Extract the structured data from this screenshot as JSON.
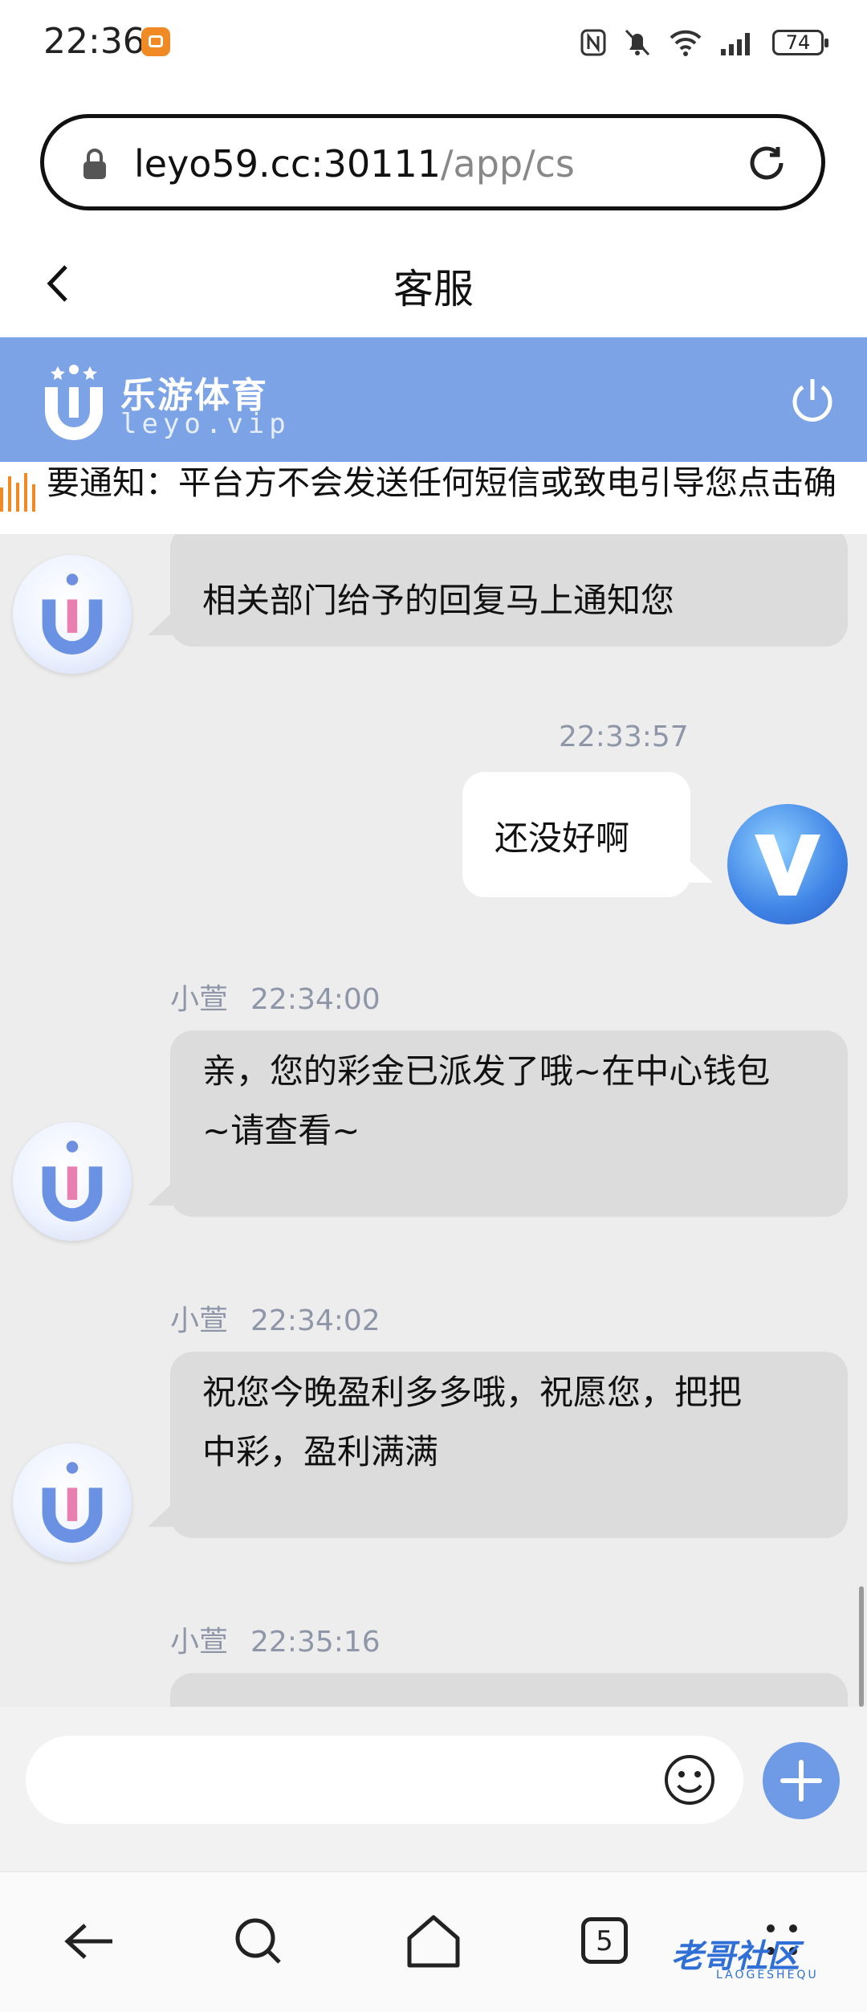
{
  "status_bar": {
    "time": "22:36",
    "battery": "74"
  },
  "browser": {
    "url_host": "leyo59.cc:30111",
    "url_path": "/app/cs",
    "page_title": "客服",
    "tabs_count": "5"
  },
  "app_header": {
    "brand_name": "乐游体育",
    "brand_sub": "leyo.vip"
  },
  "notice": {
    "text": "要通知：平台方不会发送任何短信或致电引导您点击确"
  },
  "messages": [
    {
      "side": "left",
      "name": "",
      "time": "",
      "text": "相关部门给予的回复马上通知您"
    },
    {
      "side": "right",
      "time": "22:33:57",
      "text": "还没好啊"
    },
    {
      "side": "left",
      "name": "小萱",
      "time": "22:34:00",
      "text_lines": [
        "亲，您的彩金已派发了哦~在中心钱包",
        "~请查看~"
      ]
    },
    {
      "side": "left",
      "name": "小萱",
      "time": "22:34:02",
      "text_lines": [
        "祝您今晚盈利多多哦，祝愿您，把把",
        "中彩，盈利满满"
      ]
    },
    {
      "side": "left",
      "name": "小萱",
      "time": "22:35:16",
      "text": ""
    }
  ],
  "composer": {
    "placeholder": ""
  },
  "watermark": {
    "text": "老哥社区",
    "sub": "LAOGESHEQU"
  },
  "colors": {
    "header_blue": "#7ba3e5",
    "chat_bg": "#ededed",
    "agent_bubble": "#dcdcdc",
    "plus_button": "#6e9ae6"
  }
}
